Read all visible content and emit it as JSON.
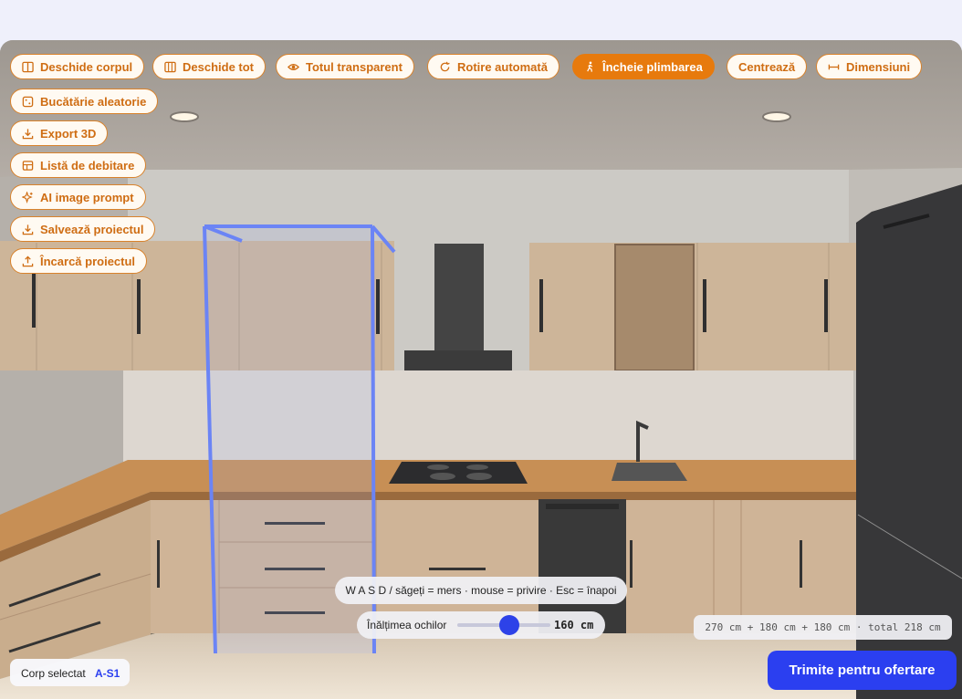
{
  "toolbar": {
    "open_body": "Deschide corpul",
    "open_all": "Deschide tot",
    "all_transparent": "Totul transparent",
    "auto_rotate": "Rotire automată",
    "end_walk": "Încheie plimbarea",
    "center": "Centrează",
    "dimensions": "Dimensiuni"
  },
  "side_menu": {
    "random_kitchen": "Bucătărie aleatorie",
    "export_3d": "Export 3D",
    "cut_list": "Listă de debitare",
    "ai_prompt": "AI image prompt",
    "save_project": "Salvează proiectul",
    "load_project": "Încarcă proiectul"
  },
  "walk_hint": "W A S D / săgeți = mers · mouse = privire · Esc = înapoi",
  "eye_height": {
    "label": "Înălțimea ochilor",
    "value_text": "160 cm",
    "fraction": 0.56
  },
  "dimensions_summary": "270 cm + 180 cm + 180 cm · total 218 cm",
  "selection": {
    "label": "Corp selectat",
    "value": "A-S1"
  },
  "submit_label": "Trimite pentru ofertare",
  "colors": {
    "accent_orange": "#e77a0d",
    "primary_blue": "#2b3ff0",
    "selection_outline": "#6b84f5"
  }
}
